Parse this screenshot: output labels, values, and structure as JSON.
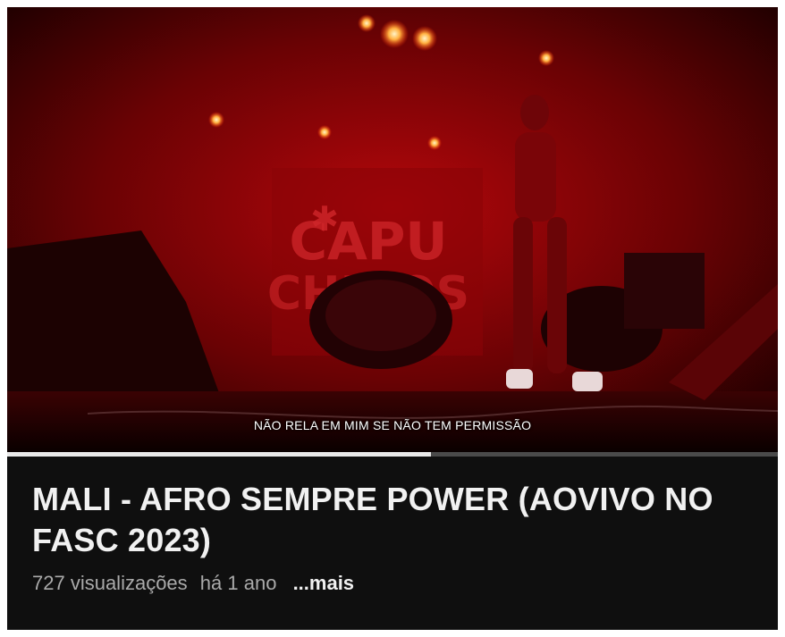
{
  "video": {
    "backdrop_text": "CAPU CHINOS",
    "caption": "NÃO RELA EM MIM SE NÃO TEM PERMISSÃO",
    "progress_fraction": 0.55,
    "accent_color": "#c0060a"
  },
  "details": {
    "title": "MALI - AFRO SEMPRE POWER (AOVIVO NO FASC 2023)",
    "views": "727 visualizações",
    "age": "há 1 ano",
    "more_label": "...mais"
  }
}
